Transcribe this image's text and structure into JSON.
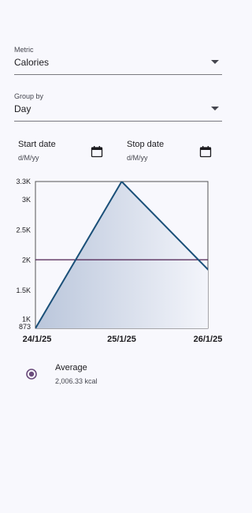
{
  "metric": {
    "label": "Metric",
    "value": "Calories",
    "icon": "arrow-drop-down-icon"
  },
  "group_by": {
    "label": "Group by",
    "value": "Day",
    "icon": "arrow-drop-down-icon"
  },
  "start_date": {
    "label": "Start date",
    "placeholder": "d/M/yy",
    "icon": "calendar-icon"
  },
  "stop_date": {
    "label": "Stop date",
    "placeholder": "d/M/yy",
    "icon": "calendar-icon"
  },
  "colors": {
    "line": "#1b5079",
    "fill_start": "#bac6db",
    "fill_end": "#f6f7fc",
    "average_line": "#4c1d4f",
    "radio": "#6b4c7c",
    "axis": "#555555"
  },
  "chart_data": {
    "type": "area",
    "x": [
      "24/1/25",
      "25/1/25",
      "26/1/25"
    ],
    "values": [
      873,
      3300,
      1846
    ],
    "average": 2006.33,
    "ylim": [
      873,
      3300
    ],
    "y_ticks": [
      {
        "value": 873,
        "label": "873"
      },
      {
        "value": 1000,
        "label": "1K"
      },
      {
        "value": 1500,
        "label": "1.5K"
      },
      {
        "value": 2000,
        "label": "2K"
      },
      {
        "value": 2500,
        "label": "2.5K"
      },
      {
        "value": 3000,
        "label": "3K"
      },
      {
        "value": 3300,
        "label": "3.3K"
      }
    ],
    "grid": false
  },
  "legend": {
    "name": "Average",
    "value": "2,006.33 kcal",
    "selected": true
  }
}
